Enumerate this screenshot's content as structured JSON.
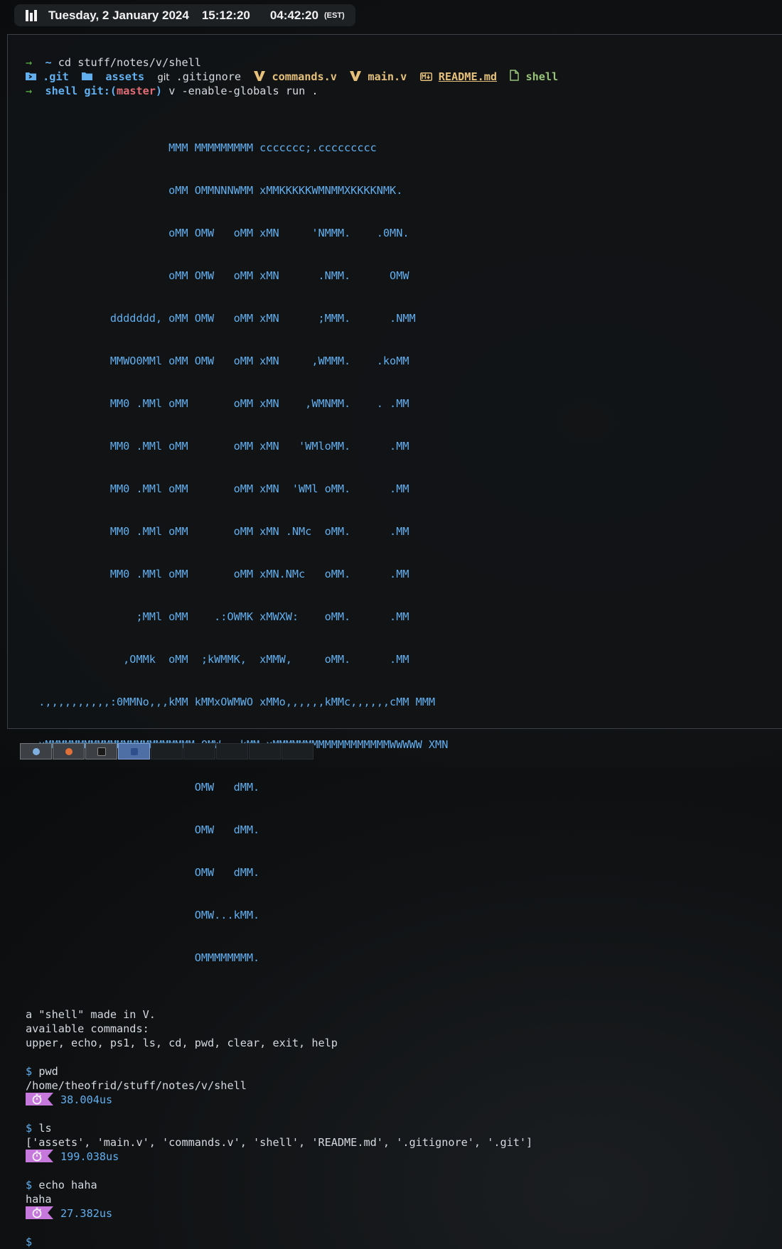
{
  "statusbar": {
    "date": "Tuesday, 2 January 2024",
    "time_local": "15:12:20",
    "time_other": "04:42:20",
    "timezone": "(EST)"
  },
  "terminal": {
    "cmd1": {
      "prompt": "→",
      "dir": "~",
      "command": "cd stuff/notes/v/shell"
    },
    "files": [
      {
        "name": ".git",
        "icon": "git-folder-icon",
        "color": "cyan"
      },
      {
        "name": "assets",
        "icon": "folder-icon",
        "color": "cyan"
      },
      {
        "name": ".gitignore",
        "icon": "git-icon",
        "color": "plain"
      },
      {
        "name": "commands.v",
        "icon": "v-lang-icon",
        "color": "yellow"
      },
      {
        "name": "main.v",
        "icon": "v-lang-icon",
        "color": "yellow"
      },
      {
        "name": "README.md",
        "icon": "markdown-icon",
        "color": "readme"
      },
      {
        "name": "shell",
        "icon": "file-icon",
        "color": "green"
      }
    ],
    "git_icon_text": "git",
    "cmd2": {
      "prompt": "→",
      "dir": "shell",
      "git_label": "git:(",
      "branch": "master",
      "git_close": ")",
      "command": "v -enable-globals run ."
    },
    "ascii_art": [
      "                      MMM MMMMMMMMM ccccccc;.ccccccccc",
      "                      oMM OMMNNNWMM xMMKKKKKWMNMMXKKKKNMK.",
      "                      oMM OMW   oMM xMN     'NMMM.    .0MN.",
      "                      oMM OMW   oMM xMN      .NMM.      OMW",
      "             ddddddd, oMM OMW   oMM xMN      ;MMM.      .NMM",
      "             MMWO0MMl oMM OMW   oMM xMN     ,WMMM.    .koMM",
      "             MM0 .MMl oMM       oMM xMN    ,WMNMM.    . .MM",
      "             MM0 .MMl oMM       oMM xMN   'WMloMM.      .MM",
      "             MM0 .MMl oMM       oMM xMN  'WMl oMM.      .MM",
      "             MM0 .MMl oMM       oMM xMN .NMc  oMM.      .MM",
      "             MM0 .MMl oMM       oMM xMN.NMc   oMM.      .MM",
      "                 ;MMl oMM    .:OWMK xMWXW:    oMM.      .MM",
      "               ,OMMk  oMM  ;kWMMK,  xMMW,     oMM.      .MM",
      "  .,,,,,,,,,,:0MMNo,,,kMM kMMxOWMWO xMMo,,,,,,kMMc,,,,,,cMM MMM",
      "  xMMMMMMMMMMMMMMMMMMMMMMM OMW   kMM xMMMMMMMMMMMMMMMMMMWWWWW XMN",
      "                          OMW   dMM.",
      "                          OMW   dMM.",
      "                          OMW   dMM.",
      "                          OMW...kMM.",
      "                          OMMMMMMMM."
    ],
    "intro": [
      "a \"shell\" made in V.",
      "available commands:",
      "upper, echo, ps1, ls, cd, pwd, clear, exit, help"
    ],
    "sessions": [
      {
        "prompt": "$",
        "command": "pwd",
        "output": "/home/theofrid/stuff/notes/v/shell",
        "timing": "38.004us"
      },
      {
        "prompt": "$",
        "command": "ls",
        "output": "['assets', 'main.v', 'commands.v', 'shell', 'README.md', '.gitignore', '.git']",
        "timing": "199.038us"
      },
      {
        "prompt": "$",
        "command": "echo haha",
        "output": "haha",
        "timing": "27.382us"
      }
    ],
    "final_prompt": "$"
  },
  "taskbar": {
    "workspaces": [
      {
        "icon": "snowflake-icon",
        "state": "used",
        "color": "#7fb0e0"
      },
      {
        "icon": "firefox-icon",
        "state": "used",
        "color": "#e0703a"
      },
      {
        "icon": "terminal-icon",
        "state": "used",
        "color": "#222222"
      },
      {
        "icon": "app-icon",
        "state": "active",
        "color": "#2e4f8c"
      },
      {
        "icon": "",
        "state": "empty"
      },
      {
        "icon": "",
        "state": "empty"
      },
      {
        "icon": "",
        "state": "empty"
      },
      {
        "icon": "",
        "state": "empty"
      },
      {
        "icon": "",
        "state": "empty"
      }
    ]
  },
  "colors": {
    "accent_blue": "#61afef",
    "prompt_green": "#5fb84a",
    "branch_red": "#e06c75",
    "file_yellow": "#e5c07b",
    "exec_green": "#98c379",
    "timer_badge": "#c678dd"
  }
}
